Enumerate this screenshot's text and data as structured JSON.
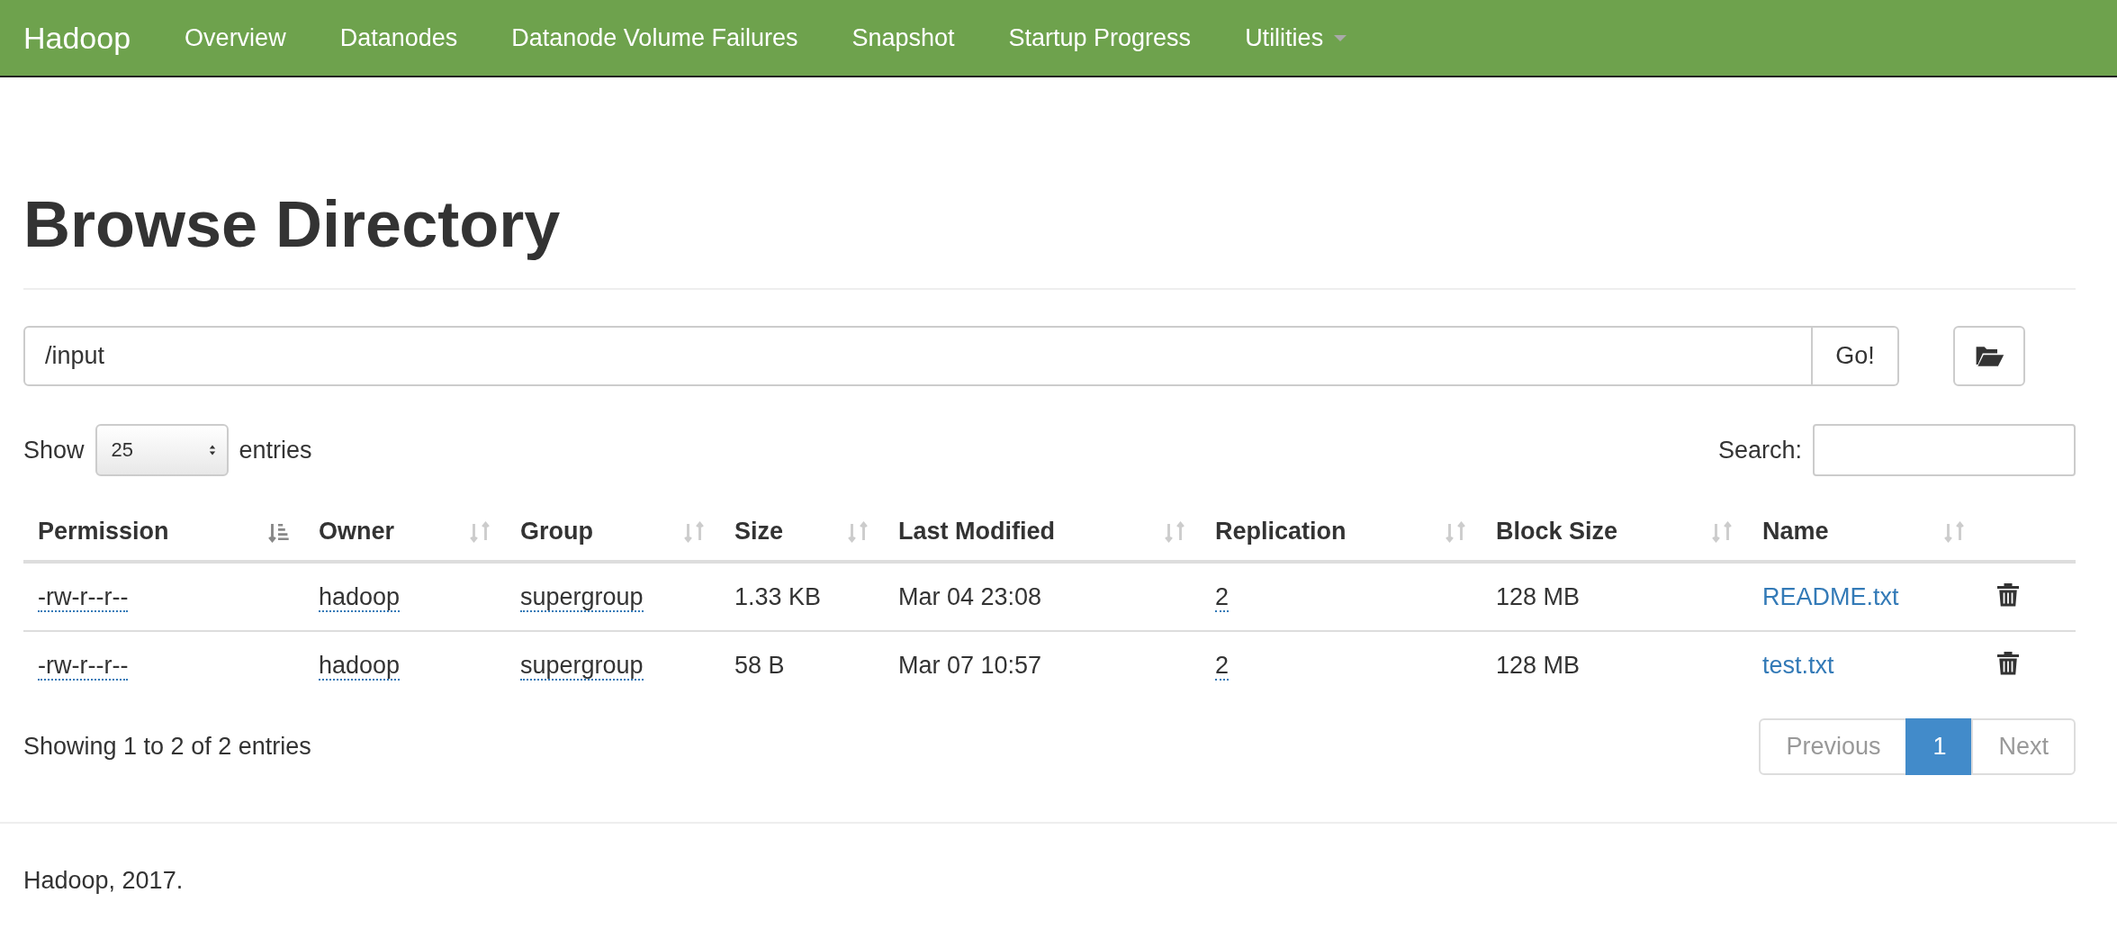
{
  "navbar": {
    "brand": "Hadoop",
    "items": [
      {
        "label": "Overview",
        "kind": "link"
      },
      {
        "label": "Datanodes",
        "kind": "link"
      },
      {
        "label": "Datanode Volume Failures",
        "kind": "link"
      },
      {
        "label": "Snapshot",
        "kind": "link"
      },
      {
        "label": "Startup Progress",
        "kind": "link"
      },
      {
        "label": "Utilities",
        "kind": "dropdown"
      }
    ]
  },
  "page_title": "Browse Directory",
  "path_field": {
    "value": "/input",
    "button": "Go!"
  },
  "length_control": {
    "before": "Show",
    "value": "25",
    "after": "entries"
  },
  "search": {
    "label": "Search:"
  },
  "table": {
    "columns": [
      {
        "label": "Permission",
        "kind": "dotted",
        "sorted": true
      },
      {
        "label": "Owner",
        "kind": "dotted",
        "sorted": false
      },
      {
        "label": "Group",
        "kind": "dotted",
        "sorted": false
      },
      {
        "label": "Size",
        "kind": "plain",
        "sorted": false
      },
      {
        "label": "Last Modified",
        "kind": "plain",
        "sorted": false
      },
      {
        "label": "Replication",
        "kind": "dotted",
        "sorted": false
      },
      {
        "label": "Block Size",
        "kind": "plain",
        "sorted": false
      },
      {
        "label": "Name",
        "kind": "link",
        "sorted": false
      }
    ],
    "rows": [
      [
        "-rw-r--r--",
        "hadoop",
        "supergroup",
        "1.33 KB",
        "Mar 04 23:08",
        "2",
        "128 MB",
        "README.txt"
      ],
      [
        "-rw-r--r--",
        "hadoop",
        "supergroup",
        "58 B",
        "Mar 07 10:57",
        "2",
        "128 MB",
        "test.txt"
      ]
    ]
  },
  "info": "Showing 1 to 2 of 2 entries",
  "pagination": [
    {
      "label": "Previous",
      "disabled": true,
      "selected": false
    },
    {
      "label": "1",
      "disabled": false,
      "selected": true
    },
    {
      "label": "Next",
      "disabled": true,
      "selected": false
    }
  ],
  "footer": "Hadoop, 2017."
}
